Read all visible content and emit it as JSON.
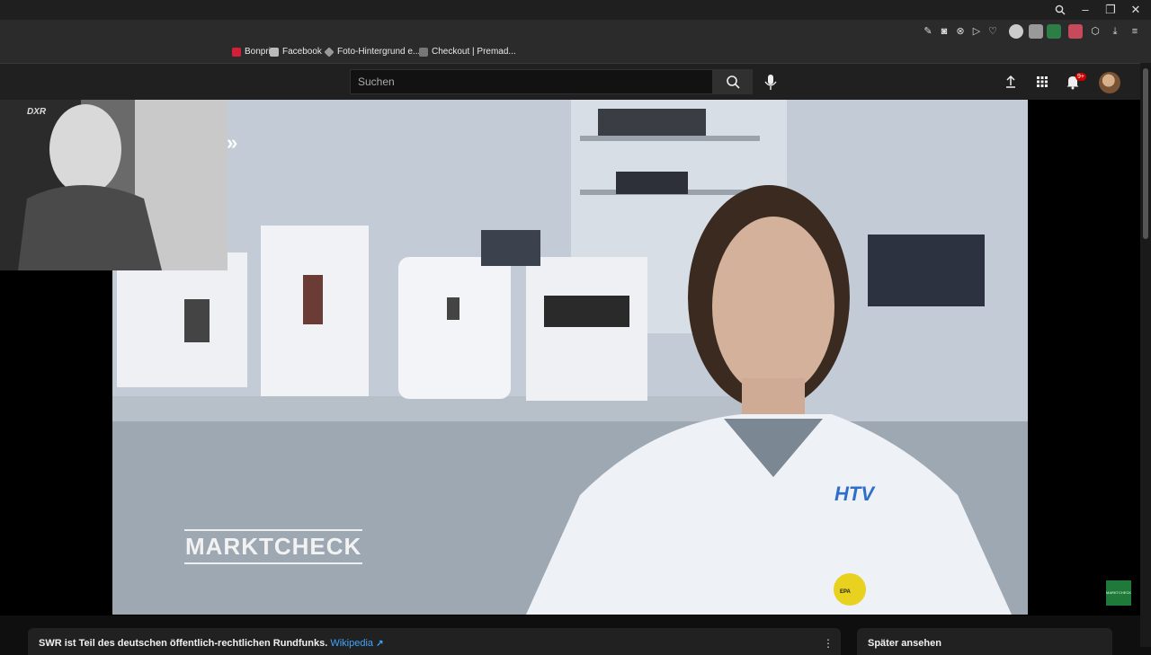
{
  "bookmarks": [
    {
      "label": "Bonprix"
    },
    {
      "label": "Facebook"
    },
    {
      "label": "Foto-Hintergrund e..."
    },
    {
      "label": "Checkout | Premad..."
    }
  ],
  "search": {
    "placeholder": "Suchen"
  },
  "header": {
    "notification_count": "9+"
  },
  "video": {
    "overlay_brand": "MARKTCHECK",
    "overlay_chevrons": "»",
    "coat_logo": "HTV",
    "badge_text": "EPA",
    "corner_logo": "MARKTCHECK"
  },
  "webcam": {
    "chair_brand": "DXR"
  },
  "info_panel": {
    "text": "SWR ist Teil des deutschen öffentlich-rechtlichen Rundfunks.",
    "link": "Wikipedia"
  },
  "sidebar": {
    "title": "Später ansehen"
  },
  "colors": {
    "accent_link": "#3ea6ff",
    "notification": "#cc0000",
    "background": "#0f0f0f"
  }
}
